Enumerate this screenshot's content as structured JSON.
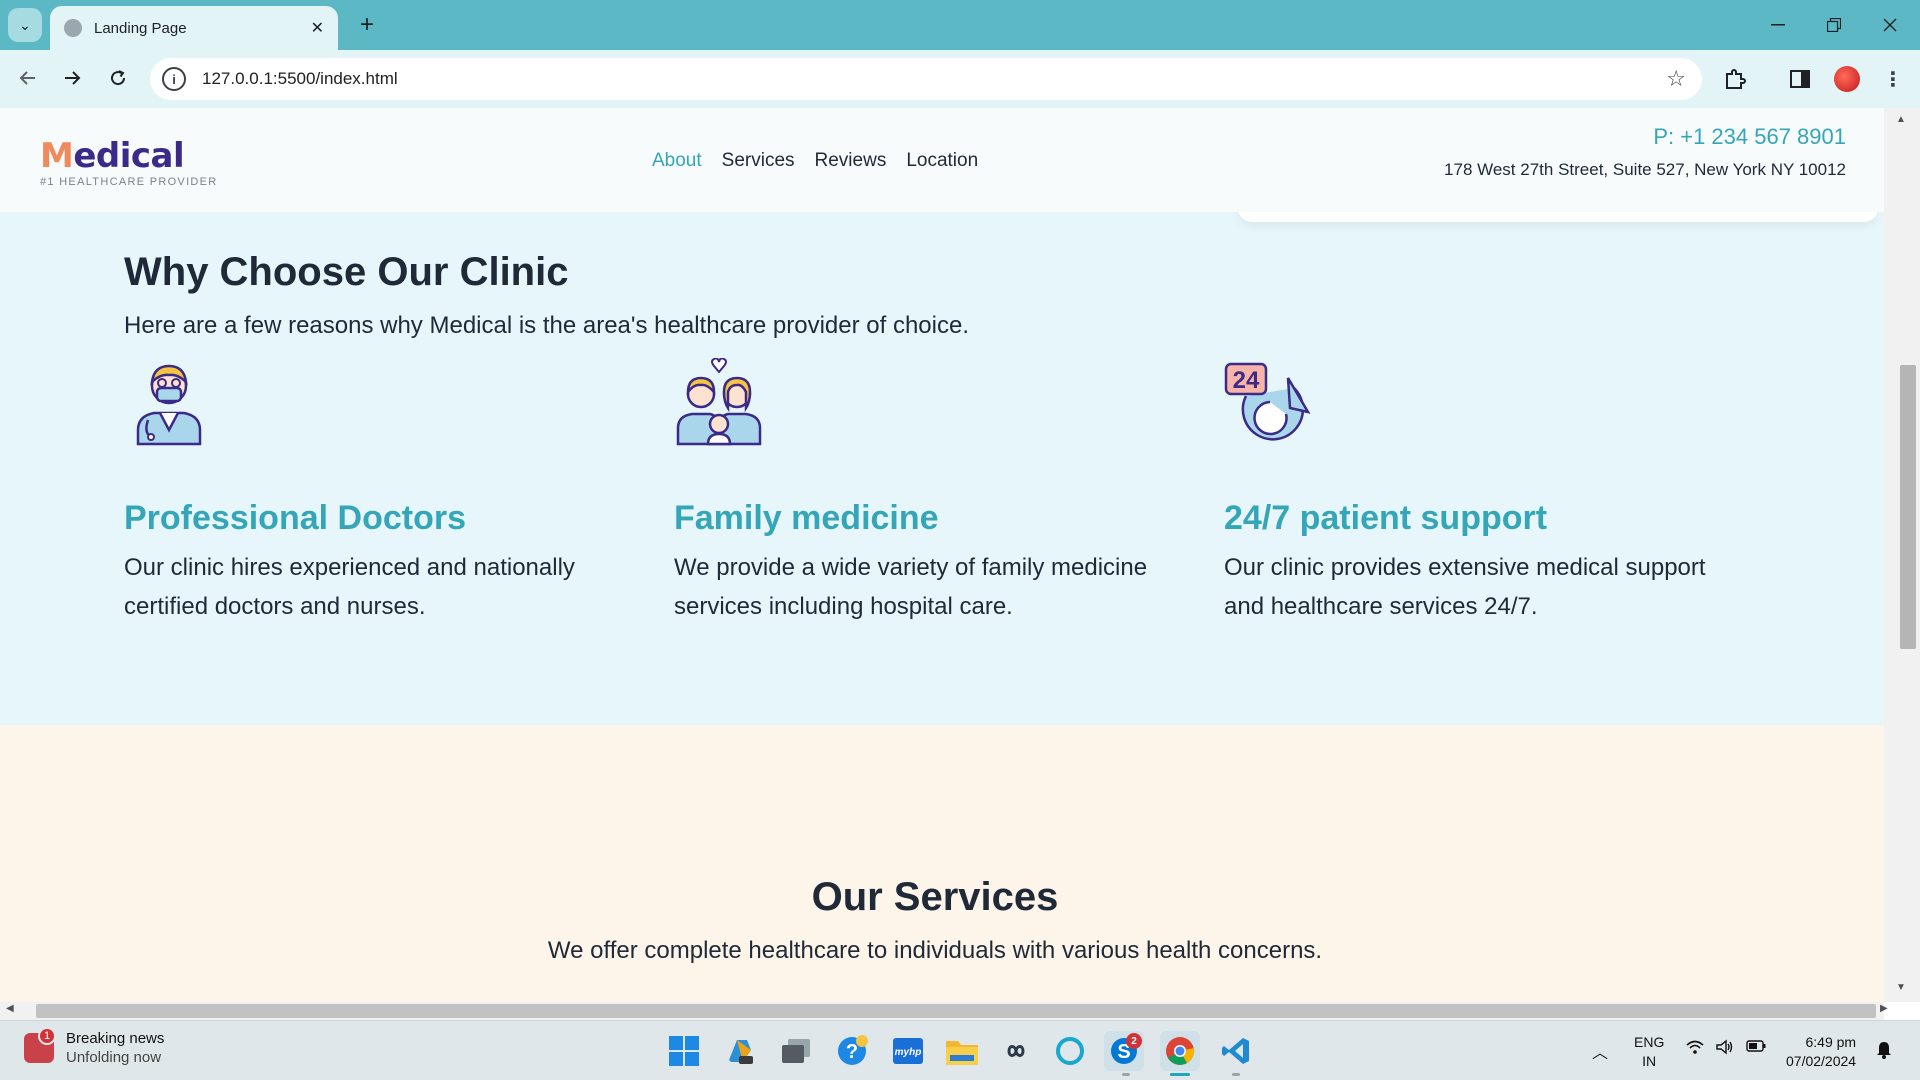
{
  "browser": {
    "tab_title": "Landing Page",
    "url": "127.0.0.1:5500/index.html",
    "new_tab_symbol": "+",
    "close_tab_symbol": "✕"
  },
  "site": {
    "logo_first_letter": "M",
    "logo_rest": "edical",
    "logo_tagline": "#1 HEALTHCARE PROVIDER",
    "nav": [
      "About",
      "Services",
      "Reviews",
      "Location"
    ],
    "active_nav": "About",
    "phone": "P: +1 234 567 8901",
    "address": "178 West 27th Street, Suite 527, New York NY 10012"
  },
  "why": {
    "title": "Why Choose Our Clinic",
    "subtitle": "Here are a few reasons why Medical is the area's healthcare provider of choice.",
    "features": [
      {
        "icon": "doctor-icon",
        "title": "Professional Doctors",
        "desc": "Our clinic hires experienced and nationally certified doctors and nurses."
      },
      {
        "icon": "family-icon",
        "title": "Family medicine",
        "desc": "We provide a wide variety of family medicine services including hospital care."
      },
      {
        "icon": "24-7-support-icon",
        "title": "24/7 patient support",
        "desc": "Our clinic provides extensive medical support and healthcare services 24/7."
      }
    ],
    "support_icon_text": "24"
  },
  "services": {
    "title": "Our Services",
    "subtitle": "We offer complete healthcare to individuals with various health concerns."
  },
  "taskbar": {
    "news_title": "Breaking news",
    "news_sub": "Unfolding now",
    "news_badge": "1",
    "skype_badge": "2",
    "lang_line1": "ENG",
    "lang_line2": "IN",
    "time": "6:49 pm",
    "date": "07/02/2024"
  },
  "colors": {
    "accent": "#35a6b8",
    "logo_purple": "#3b2a87",
    "logo_orange": "#f08a5d",
    "why_bg": "#e6f6fb",
    "services_bg": "#fdf4ea",
    "chrome_teal": "#5bb8c4"
  }
}
